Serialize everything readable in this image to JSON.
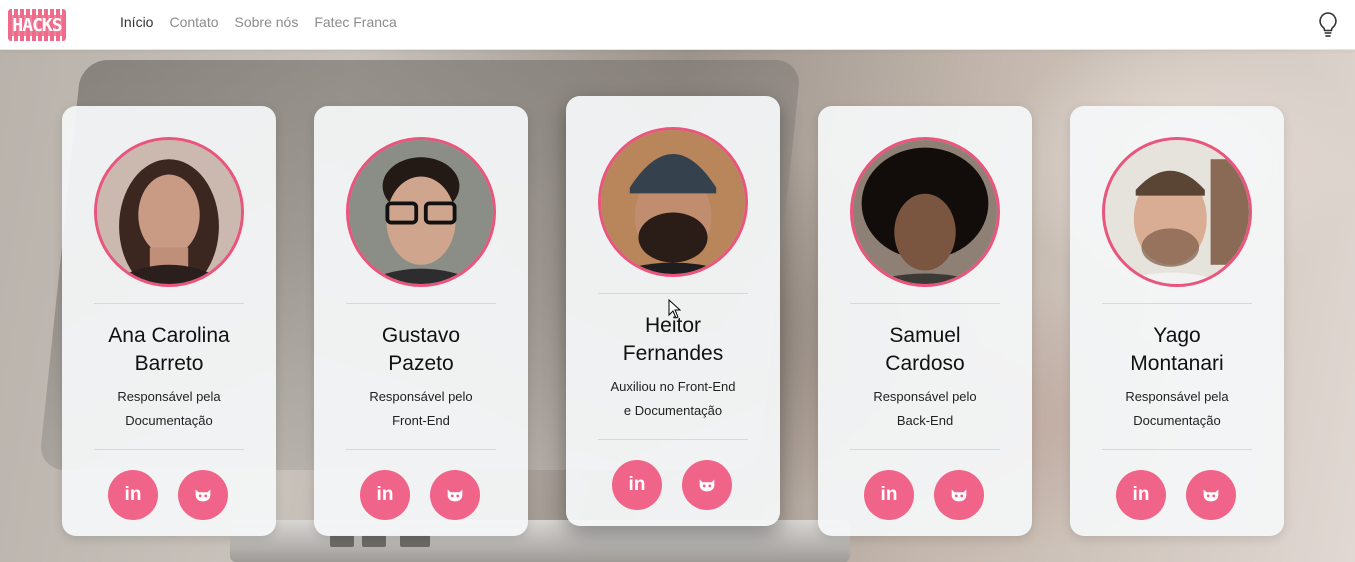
{
  "brand": {
    "logo_text": "HACKS"
  },
  "nav": {
    "items": [
      {
        "label": "Início",
        "active": true
      },
      {
        "label": "Contato"
      },
      {
        "label": "Sobre nós"
      },
      {
        "label": "Fatec Franca"
      }
    ],
    "theme_icon": "lightbulb-icon"
  },
  "colors": {
    "accent": "#f1648a",
    "avatar_border": "#e9557c"
  },
  "cards": [
    {
      "name": "Ana Carolina Barreto",
      "name_line1": "Ana Carolina",
      "name_line2": "Barreto",
      "role_line1": "Responsável pela",
      "role_line2": "Documentação",
      "icons": [
        "linkedin-icon",
        "github-icon"
      ]
    },
    {
      "name": "Gustavo Pazeto",
      "name_line1": "Gustavo",
      "name_line2": "Pazeto",
      "role_line1": "Responsável pelo",
      "role_line2": "Front-End",
      "icons": [
        "linkedin-icon",
        "github-icon"
      ]
    },
    {
      "name": "Heitor Fernandes",
      "name_line1": "Heitor",
      "name_line2": "Fernandes",
      "role_line1": "Auxiliou no Front-End",
      "role_line2": "e Documentação",
      "icons": [
        "linkedin-icon",
        "github-icon"
      ]
    },
    {
      "name": "Samuel Cardoso",
      "name_line1": "Samuel",
      "name_line2": "Cardoso",
      "role_line1": "Responsável pelo",
      "role_line2": "Back-End",
      "icons": [
        "linkedin-icon",
        "github-icon"
      ]
    },
    {
      "name": "Yago Montanari",
      "name_line1": "Yago",
      "name_line2": "Montanari",
      "role_line1": "Responsável pela",
      "role_line2": "Documentação",
      "icons": [
        "linkedin-icon",
        "github-icon"
      ]
    }
  ],
  "social": {
    "linkedin_label": "in"
  }
}
